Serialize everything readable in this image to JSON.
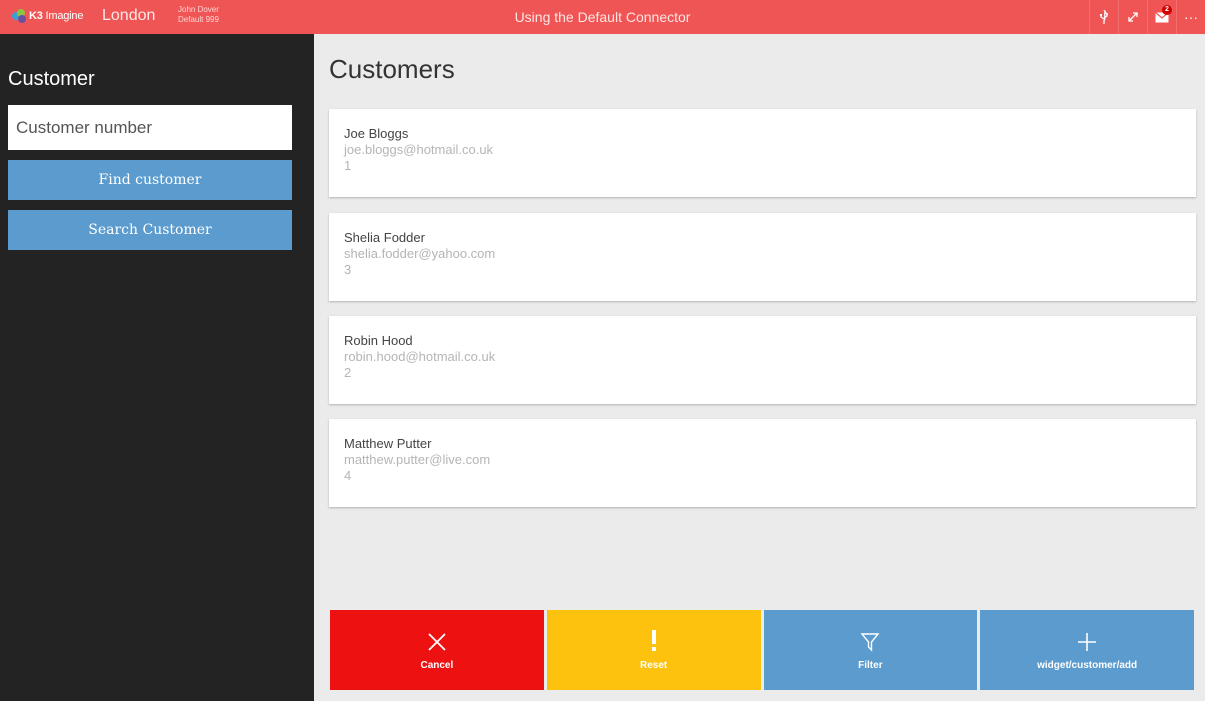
{
  "topbar": {
    "brand_bold": "K3",
    "brand_sub": "Imagine",
    "location": "London",
    "user_name": "John Dover",
    "user_store": "Default 999",
    "title": "Using the Default Connector",
    "icons": [
      "usb-icon",
      "expand-icon",
      "mail-icon",
      "more-icon"
    ],
    "mail_badge": "2"
  },
  "sidebar": {
    "title": "Customer",
    "input_placeholder": "Customer number",
    "find_label": "Find customer",
    "search_label": "Search Customer"
  },
  "main": {
    "title": "Customers",
    "customers": [
      {
        "name": "Joe Bloggs",
        "email": "joe.bloggs@hotmail.co.uk",
        "number": "1"
      },
      {
        "name": "Shelia Fodder",
        "email": "shelia.fodder@yahoo.com",
        "number": "3"
      },
      {
        "name": "Robin Hood",
        "email": "robin.hood@hotmail.co.uk",
        "number": "2"
      },
      {
        "name": "Matthew Putter",
        "email": "matthew.putter@live.com",
        "number": "4"
      }
    ],
    "actions": {
      "cancel": "Cancel",
      "reset": "Reset",
      "filter": "Filter",
      "add": "widget/customer/add"
    }
  },
  "colors": {
    "topbar": "#f05555",
    "sidebar": "#232323",
    "primary": "#5b9bcd",
    "cancel": "#ee1111",
    "reset": "#fdc20e"
  }
}
